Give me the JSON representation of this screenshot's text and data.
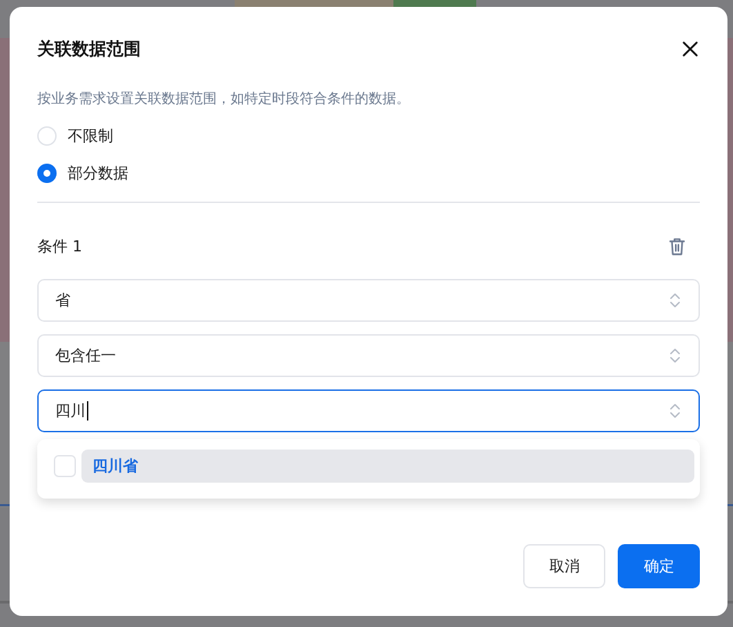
{
  "dialog": {
    "title": "关联数据范围",
    "description": "按业务需求设置关联数据范围，如特定时段符合条件的数据。",
    "scope_options": [
      {
        "label": "不限制",
        "selected": false
      },
      {
        "label": "部分数据",
        "selected": true
      }
    ],
    "conditions": [
      {
        "label": "条件 1",
        "field": {
          "value": "省",
          "focused": false
        },
        "operator": {
          "value": "包含任一",
          "focused": false
        },
        "values": {
          "value": "四川",
          "focused": true
        }
      }
    ],
    "dropdown": {
      "options": [
        {
          "label": "四川省",
          "checked": false,
          "highlighted": true
        }
      ]
    },
    "buttons": [
      {
        "label": "取消",
        "kind": "secondary"
      },
      {
        "label": "确定",
        "kind": "primary"
      }
    ]
  }
}
